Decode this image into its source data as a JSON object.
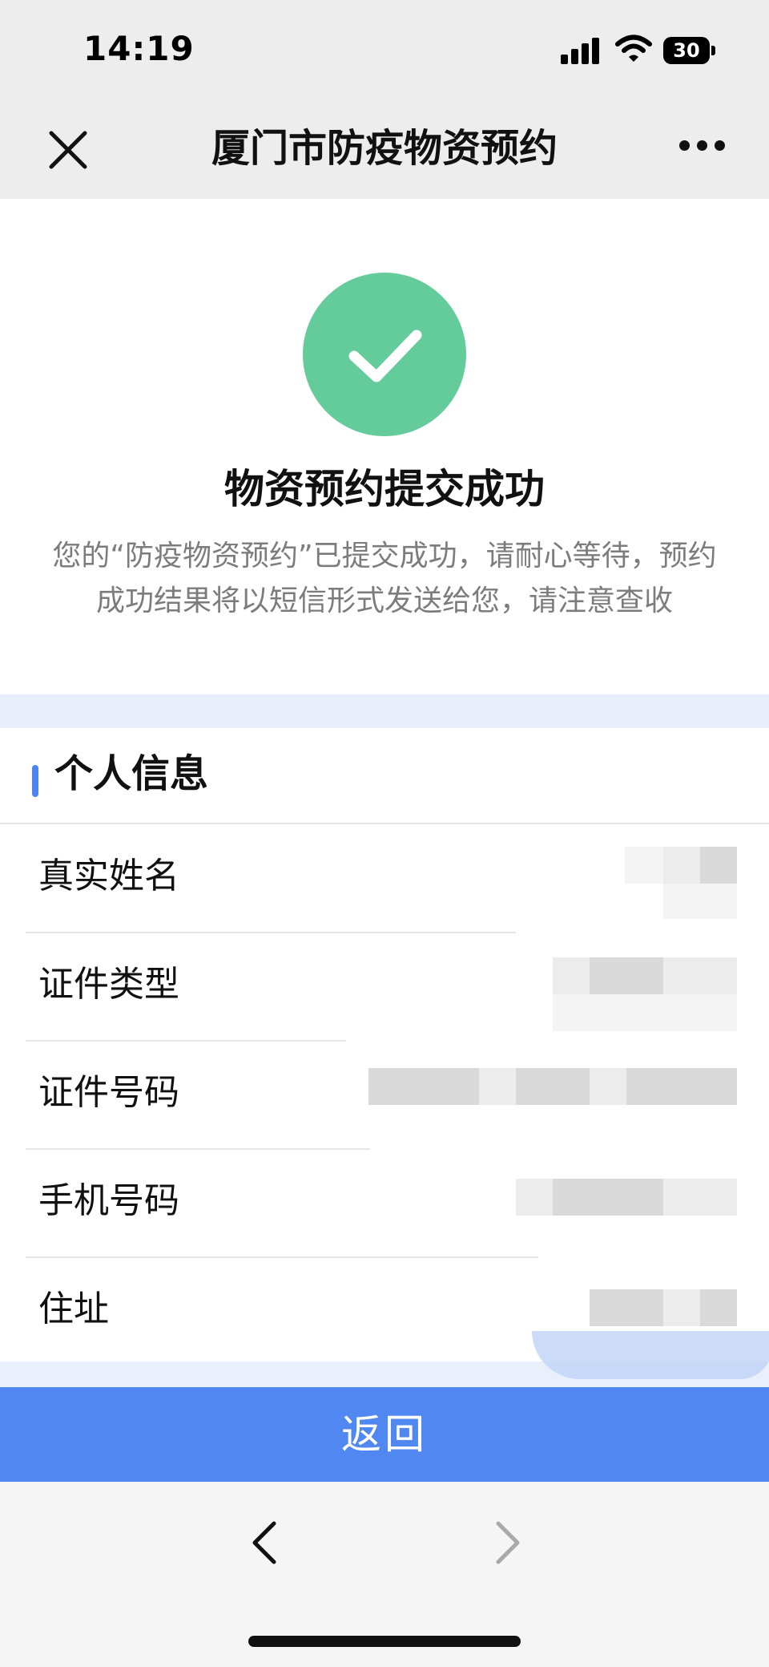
{
  "status_bar": {
    "time": "14:19",
    "battery": "30",
    "icons": [
      "signal-icon",
      "wifi-icon",
      "battery-icon"
    ]
  },
  "nav": {
    "title": "厦门市防疫物资预约",
    "close_icon": "close-icon",
    "more_icon": "more-icon"
  },
  "success": {
    "icon": "check-icon",
    "icon_color": "#64cb9b",
    "title": "物资预约提交成功",
    "description": "您的“防疫物资预约”已提交成功，请耐心等待，预约成功结果将以短信形式发送给您，请注意查收"
  },
  "personal_info": {
    "title": "个人信息",
    "accent": "#4c84f0",
    "rows": [
      {
        "label": "真实姓名",
        "value": ""
      },
      {
        "label": "证件类型",
        "value": ""
      },
      {
        "label": "证件号码",
        "value": ""
      },
      {
        "label": "手机号码",
        "value": ""
      },
      {
        "label": "住址",
        "value": ""
      }
    ]
  },
  "actions": {
    "return_label": "返回",
    "return_color": "#5187f1"
  },
  "toolbar": {
    "back_icon": "chevron-left-icon",
    "forward_icon": "chevron-right-icon"
  }
}
